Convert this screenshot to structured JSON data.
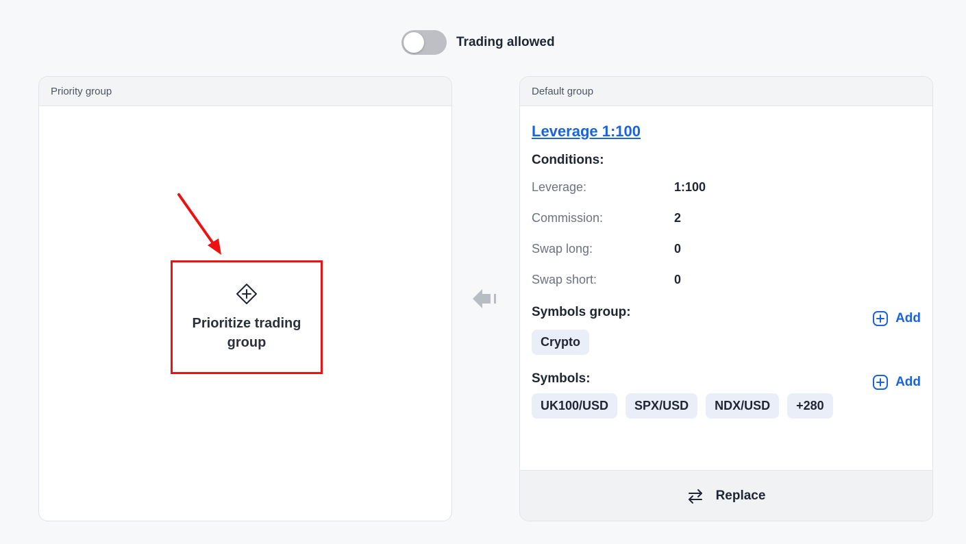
{
  "toggle": {
    "label": "Trading allowed",
    "state": "off"
  },
  "priority_group": {
    "header": "Priority group",
    "action_label": "Prioritize trading group",
    "action_icon": "diamond-plus-icon",
    "highlight_color": "#ee1111"
  },
  "middle_icon": "arrow-left-icon",
  "default_group": {
    "header": "Default group",
    "link_text": "Leverage 1:100",
    "conditions_title": "Conditions:",
    "conditions": [
      {
        "label": "Leverage:",
        "value": "1:100"
      },
      {
        "label": "Commission:",
        "value": "2"
      },
      {
        "label": "Swap long:",
        "value": "0"
      },
      {
        "label": "Swap short:",
        "value": "0"
      }
    ],
    "symbols_group_title": "Symbols group:",
    "symbols_group_add": "Add",
    "symbols_groups": [
      "Crypto"
    ],
    "symbols_title": "Symbols:",
    "symbols_add": "Add",
    "symbols": [
      "UK100/USD",
      "SPX/USD",
      "NDX/USD",
      "+280"
    ],
    "footer_label": "Replace",
    "footer_icon": "swap-arrows-icon"
  },
  "colors": {
    "accent": "#1a63e0",
    "chip_bg": "#e9eef8",
    "toggle_off": "#bdbfc4"
  }
}
